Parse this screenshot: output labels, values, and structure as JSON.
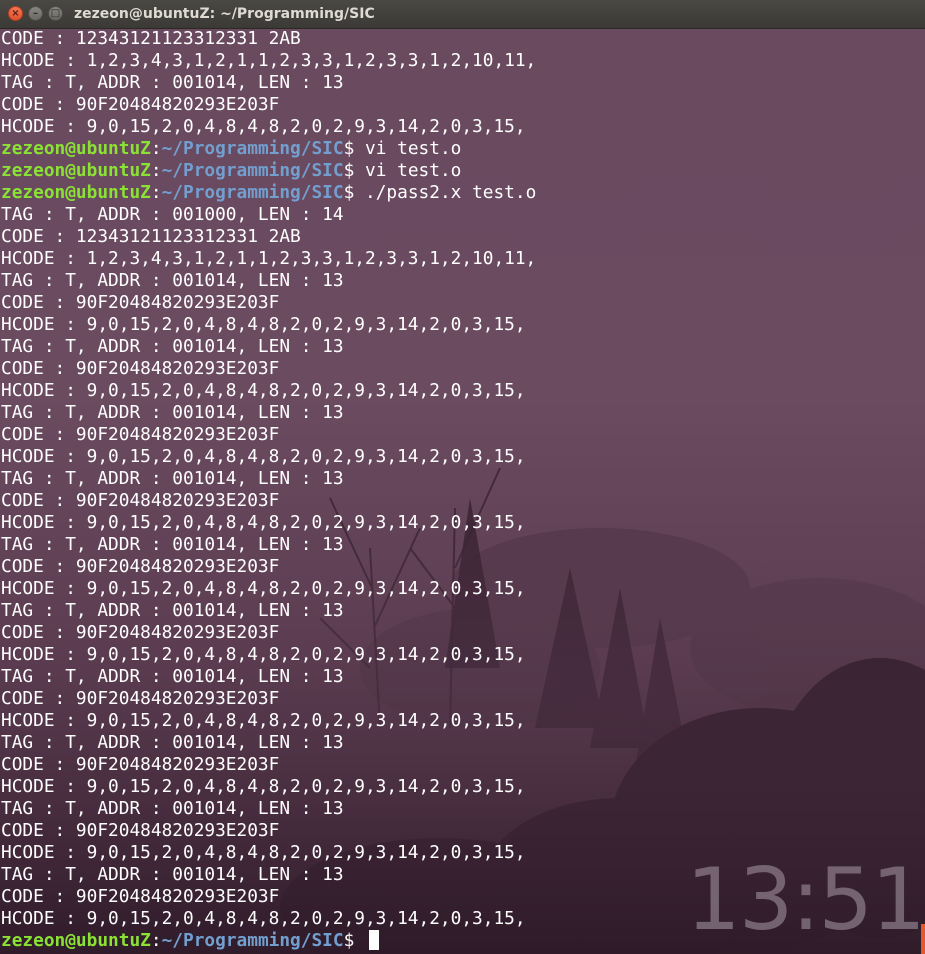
{
  "window": {
    "title": "zezeon@ubuntuZ: ~/Programming/SIC",
    "close_glyph": "×",
    "minimize_glyph": "–",
    "maximize_glyph": "□"
  },
  "wallpaper": {
    "clock": "13:51"
  },
  "terminal": {
    "lines": [
      {
        "type": "out",
        "text": "CODE : 12343121123312331 2AB"
      },
      {
        "type": "out",
        "text": "HCODE : 1,2,3,4,3,1,2,1,1,2,3,3,1,2,3,3,1,2,10,11,"
      },
      {
        "type": "out",
        "text": "TAG : T, ADDR : 001014, LEN : 13"
      },
      {
        "type": "out",
        "text": "CODE : 90F20484820293E203F"
      },
      {
        "type": "out",
        "text": "HCODE : 9,0,15,2,0,4,8,4,8,2,0,2,9,3,14,2,0,3,15,"
      },
      {
        "type": "prompt",
        "user": "zezeon@ubuntuZ",
        "sep": ":",
        "path": "~/Programming/SIC",
        "sym": "$",
        "cmd": " vi test.o"
      },
      {
        "type": "prompt",
        "user": "zezeon@ubuntuZ",
        "sep": ":",
        "path": "~/Programming/SIC",
        "sym": "$",
        "cmd": " vi test.o"
      },
      {
        "type": "prompt",
        "user": "zezeon@ubuntuZ",
        "sep": ":",
        "path": "~/Programming/SIC",
        "sym": "$",
        "cmd": " ./pass2.x test.o"
      },
      {
        "type": "out",
        "text": "TAG : T, ADDR : 001000, LEN : 14"
      },
      {
        "type": "out",
        "text": "CODE : 12343121123312331 2AB"
      },
      {
        "type": "out",
        "text": "HCODE : 1,2,3,4,3,1,2,1,1,2,3,3,1,2,3,3,1,2,10,11,"
      },
      {
        "type": "out",
        "text": "TAG : T, ADDR : 001014, LEN : 13"
      },
      {
        "type": "out",
        "text": "CODE : 90F20484820293E203F"
      },
      {
        "type": "out",
        "text": "HCODE : 9,0,15,2,0,4,8,4,8,2,0,2,9,3,14,2,0,3,15,"
      },
      {
        "type": "out",
        "text": "TAG : T, ADDR : 001014, LEN : 13"
      },
      {
        "type": "out",
        "text": "CODE : 90F20484820293E203F"
      },
      {
        "type": "out",
        "text": "HCODE : 9,0,15,2,0,4,8,4,8,2,0,2,9,3,14,2,0,3,15,"
      },
      {
        "type": "out",
        "text": "TAG : T, ADDR : 001014, LEN : 13"
      },
      {
        "type": "out",
        "text": "CODE : 90F20484820293E203F"
      },
      {
        "type": "out",
        "text": "HCODE : 9,0,15,2,0,4,8,4,8,2,0,2,9,3,14,2,0,3,15,"
      },
      {
        "type": "out",
        "text": "TAG : T, ADDR : 001014, LEN : 13"
      },
      {
        "type": "out",
        "text": "CODE : 90F20484820293E203F"
      },
      {
        "type": "out",
        "text": "HCODE : 9,0,15,2,0,4,8,4,8,2,0,2,9,3,14,2,0,3,15,"
      },
      {
        "type": "out",
        "text": "TAG : T, ADDR : 001014, LEN : 13"
      },
      {
        "type": "out",
        "text": "CODE : 90F20484820293E203F"
      },
      {
        "type": "out",
        "text": "HCODE : 9,0,15,2,0,4,8,4,8,2,0,2,9,3,14,2,0,3,15,"
      },
      {
        "type": "out",
        "text": "TAG : T, ADDR : 001014, LEN : 13"
      },
      {
        "type": "out",
        "text": "CODE : 90F20484820293E203F"
      },
      {
        "type": "out",
        "text": "HCODE : 9,0,15,2,0,4,8,4,8,2,0,2,9,3,14,2,0,3,15,"
      },
      {
        "type": "out",
        "text": "TAG : T, ADDR : 001014, LEN : 13"
      },
      {
        "type": "out",
        "text": "CODE : 90F20484820293E203F"
      },
      {
        "type": "out",
        "text": "HCODE : 9,0,15,2,0,4,8,4,8,2,0,2,9,3,14,2,0,3,15,"
      },
      {
        "type": "out",
        "text": "TAG : T, ADDR : 001014, LEN : 13"
      },
      {
        "type": "out",
        "text": "CODE : 90F20484820293E203F"
      },
      {
        "type": "out",
        "text": "HCODE : 9,0,15,2,0,4,8,4,8,2,0,2,9,3,14,2,0,3,15,"
      },
      {
        "type": "out",
        "text": "TAG : T, ADDR : 001014, LEN : 13"
      },
      {
        "type": "out",
        "text": "CODE : 90F20484820293E203F"
      },
      {
        "type": "out",
        "text": "HCODE : 9,0,15,2,0,4,8,4,8,2,0,2,9,3,14,2,0,3,15,"
      },
      {
        "type": "out",
        "text": "TAG : T, ADDR : 001014, LEN : 13"
      },
      {
        "type": "out",
        "text": "CODE : 90F20484820293E203F"
      },
      {
        "type": "out",
        "text": "HCODE : 9,0,15,2,0,4,8,4,8,2,0,2,9,3,14,2,0,3,15,"
      },
      {
        "type": "prompt",
        "user": "zezeon@ubuntuZ",
        "sep": ":",
        "path": "~/Programming/SIC",
        "sym": "$",
        "cmd": " ",
        "cursor": true
      }
    ]
  },
  "colors": {
    "prompt_user": "#8ae234",
    "prompt_path": "#729fcf",
    "text": "#ffffff",
    "close_button": "#e95420"
  }
}
